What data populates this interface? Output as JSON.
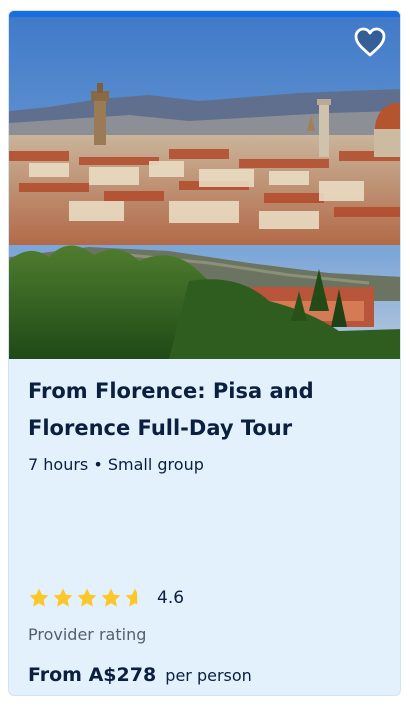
{
  "card": {
    "title": "From Florence: Pisa and Florence Full-Day Tour",
    "duration": "7 hours",
    "separator": "•",
    "group": "Small group",
    "rating": {
      "value": "4.6",
      "stars_filled": 4.6,
      "stars_total": 5,
      "label": "Provider rating"
    },
    "price": {
      "amount": "From A$278",
      "unit": "per person"
    },
    "favorite_icon": "heart-outline-icon",
    "image_subject": "florence-city-panorama"
  },
  "colors": {
    "accent": "#1a6ee0",
    "card_background": "#e3f1fd",
    "text": "#0b1f3f",
    "muted_text": "#55606e",
    "star": "#fcc72a"
  }
}
